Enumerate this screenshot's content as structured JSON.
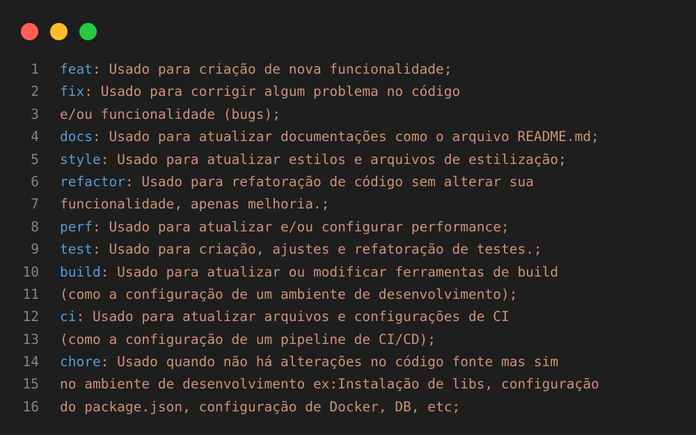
{
  "window": {
    "buttons": {
      "close_color": "#ff5f56",
      "minimize_color": "#ffbd2e",
      "maximize_color": "#27c93f"
    }
  },
  "colors": {
    "background": "#1e1e1e",
    "line_number": "#858585",
    "keyword": "#569cd6",
    "text": "#ce9178"
  },
  "lines": [
    {
      "n": "1",
      "kw": "feat",
      "text": ": Usado para criação de nova funcionalidade;"
    },
    {
      "n": "2",
      "kw": "fix",
      "text": ": Usado para corrigir algum problema no código"
    },
    {
      "n": "3",
      "kw": "",
      "text": "e/ou funcionalidade (bugs);"
    },
    {
      "n": "4",
      "kw": "docs",
      "text": ": Usado para atualizar documentações como o arquivo README.md;"
    },
    {
      "n": "5",
      "kw": "style",
      "text": ": Usado para atualizar estilos e arquivos de estilização;"
    },
    {
      "n": "6",
      "kw": "refactor",
      "text": ": Usado para refatoração de código sem alterar sua"
    },
    {
      "n": "7",
      "kw": "",
      "text": "funcionalidade, apenas melhoria.;"
    },
    {
      "n": "8",
      "kw": "perf",
      "text": ": Usado para atualizar e/ou configurar performance;"
    },
    {
      "n": "9",
      "kw": "test",
      "text": ": Usado para criação, ajustes e refatoração de testes.;"
    },
    {
      "n": "10",
      "kw": "build",
      "text": ": Usado para atualizar ou modificar ferramentas de build"
    },
    {
      "n": "11",
      "kw": "",
      "text": "(como a configuração de um ambiente de desenvolvimento);"
    },
    {
      "n": "12",
      "kw": "ci",
      "text": ": Usado para atualizar arquivos e configurações de CI"
    },
    {
      "n": "13",
      "kw": "",
      "text": "(como a configuração de um pipeline de CI/CD);"
    },
    {
      "n": "14",
      "kw": "chore",
      "text": ": Usado quando não há alterações no código fonte mas sim"
    },
    {
      "n": "15",
      "kw": "",
      "text": "no ambiente de desenvolvimento ex:Instalação de libs, configuração"
    },
    {
      "n": "16",
      "kw": "",
      "text": "do package.json, configuração de Docker, DB, etc;"
    }
  ]
}
